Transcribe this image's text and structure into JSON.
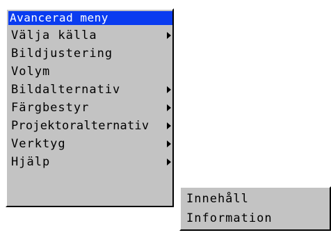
{
  "menu": {
    "title": "Avancerad meny",
    "items": [
      {
        "label": "Välja källa",
        "has_submenu": true
      },
      {
        "label": "Bildjustering",
        "has_submenu": false
      },
      {
        "label": "Volym",
        "has_submenu": false
      },
      {
        "label": "Bildalternativ",
        "has_submenu": true
      },
      {
        "label": "Färgbestyr",
        "has_submenu": true
      },
      {
        "label": "Projektoralternativ",
        "has_submenu": true
      },
      {
        "label": "Verktyg",
        "has_submenu": true
      },
      {
        "label": "Hjälp",
        "has_submenu": true
      }
    ]
  },
  "submenu": {
    "items": [
      {
        "label": "Innehåll"
      },
      {
        "label": "Information"
      }
    ]
  },
  "colors": {
    "menu_background": "#c3c3c3",
    "title_background": "#0a3cf0",
    "title_text": "#ffffff"
  },
  "icons": {
    "submenu_arrow": "right-triangle-arrow"
  }
}
